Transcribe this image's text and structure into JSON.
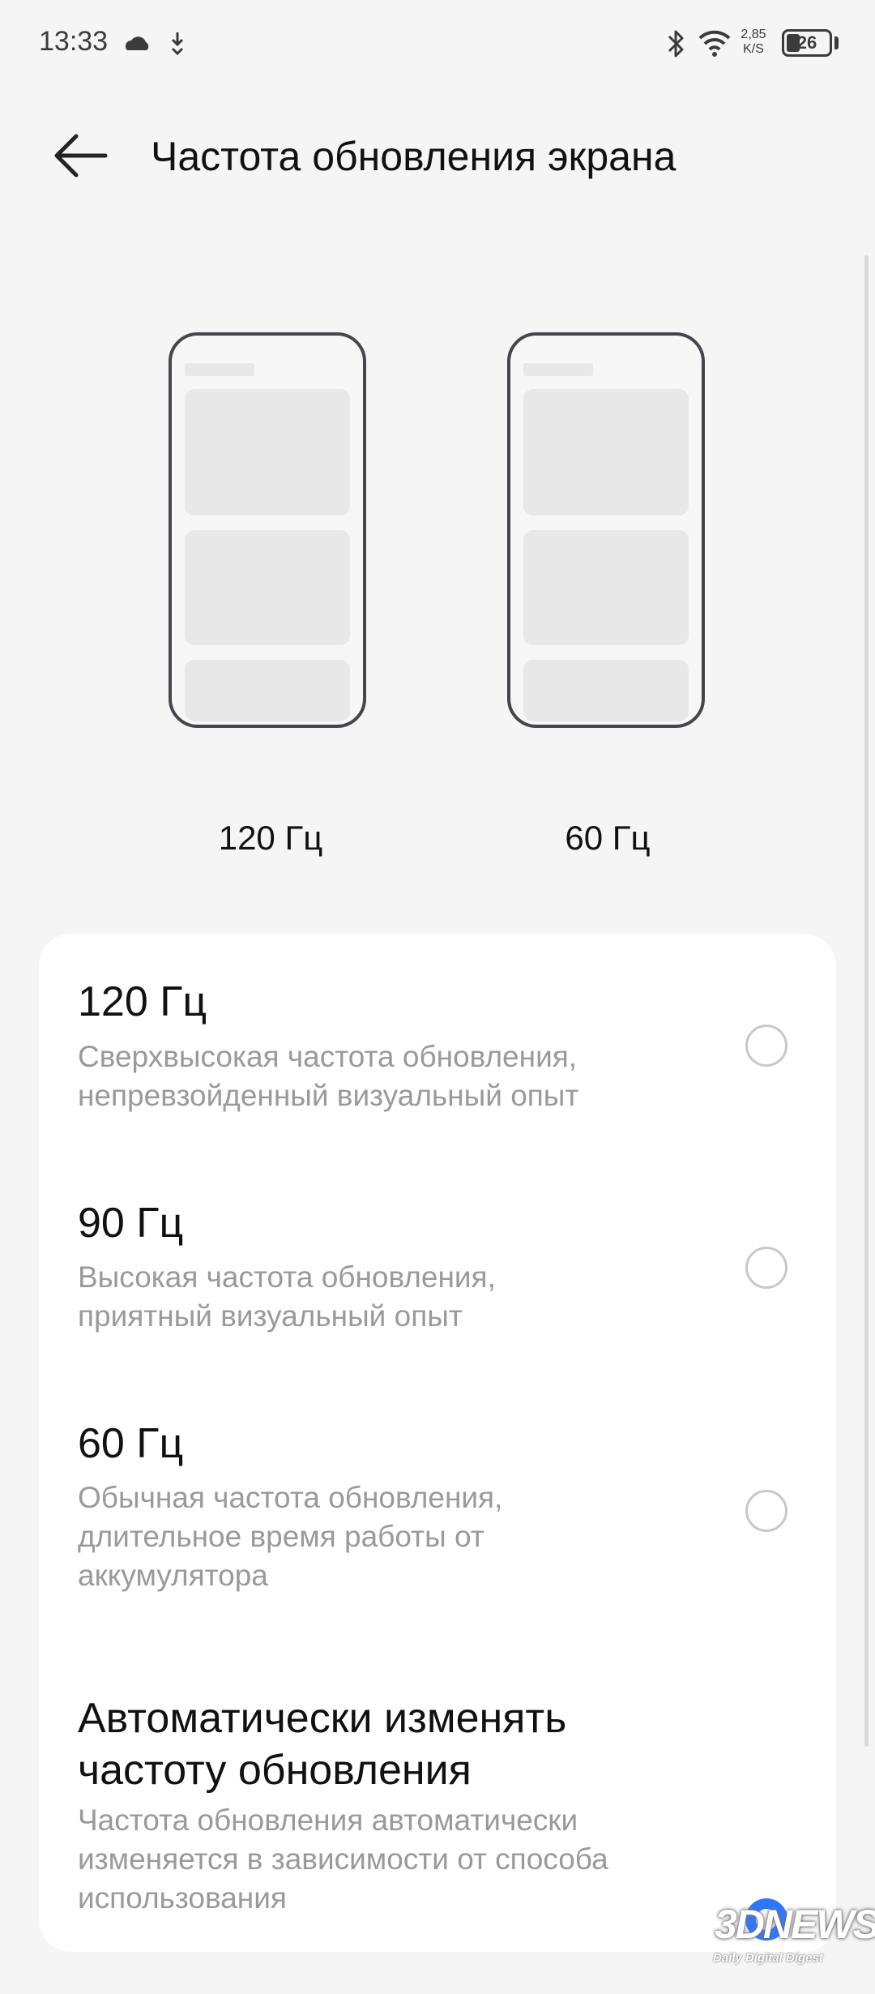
{
  "status_bar": {
    "time": "13:33",
    "net_speed_value": "2,85",
    "net_speed_unit": "K/S",
    "battery_level": "26",
    "icons": [
      "cloud-icon",
      "download-icon",
      "bluetooth-icon",
      "wifi-icon",
      "battery-icon"
    ]
  },
  "header": {
    "title": "Частота обновления экрана",
    "back_icon": "back-arrow-icon"
  },
  "previews": [
    {
      "label": "120 Гц"
    },
    {
      "label": "60 Гц"
    }
  ],
  "options": [
    {
      "title": "120 Гц",
      "description": "Сверхвысокая частота обновления, непревзойденный визуальный опыт",
      "selected": false
    },
    {
      "title": "90 Гц",
      "description": "Высокая частота обновления, приятный визуальный опыт",
      "selected": false
    },
    {
      "title": "60 Гц",
      "description": "Обычная частота обновления, длительное время работы от аккумулятора",
      "selected": false
    },
    {
      "title": "Автоматически изменять частоту обновления",
      "description": "Частота обновления автоматически изменяется в зависимости от способа использования",
      "selected": true
    }
  ],
  "watermark": {
    "main": "3DNEWS",
    "sub": "Daily Digital Digest"
  },
  "colors": {
    "background": "#f5f5f5",
    "card": "#ffffff",
    "accent": "#2f76ff",
    "secondary_text": "#9a9a9a"
  }
}
